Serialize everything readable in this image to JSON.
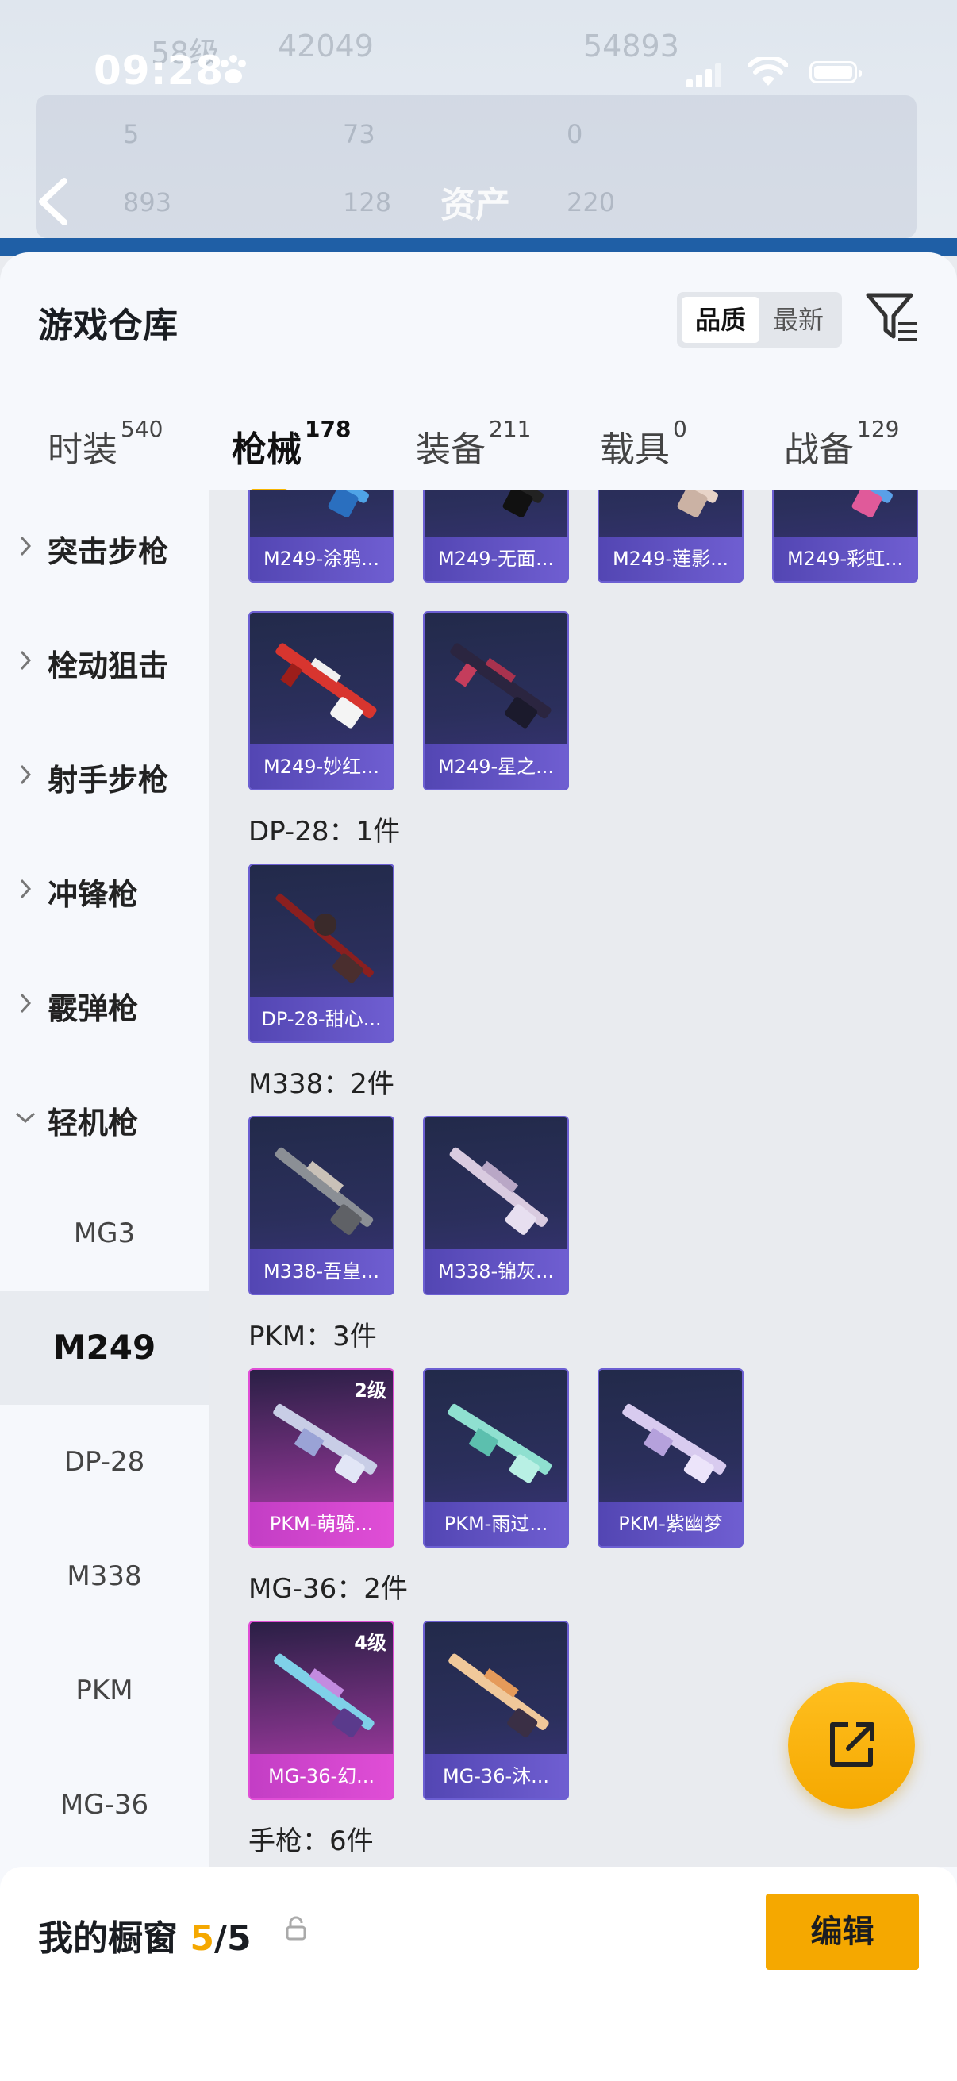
{
  "status_bar": {
    "time": "09:28"
  },
  "background": {
    "ghost_texts": [
      "58级",
      "42049",
      "54893",
      "5",
      "73",
      "0",
      "893",
      "128",
      "220"
    ],
    "title": "资产"
  },
  "sheet": {
    "title": "游戏仓库",
    "sort_options": [
      {
        "label": "品质",
        "active": true
      },
      {
        "label": "最新",
        "active": false
      }
    ]
  },
  "tabs": [
    {
      "label": "时装",
      "count": "540"
    },
    {
      "label": "枪械",
      "count": "178",
      "active": true
    },
    {
      "label": "装备",
      "count": "211"
    },
    {
      "label": "载具",
      "count": "0"
    },
    {
      "label": "战备",
      "count": "129"
    }
  ],
  "sidebar": {
    "categories": [
      {
        "label": "突击步枪",
        "expanded": false
      },
      {
        "label": "栓动狙击",
        "expanded": false
      },
      {
        "label": "射手步枪",
        "expanded": false
      },
      {
        "label": "冲锋枪",
        "expanded": false
      },
      {
        "label": "霰弹枪",
        "expanded": false
      },
      {
        "label": "轻机枪",
        "expanded": true
      }
    ],
    "subitems": [
      {
        "label": "MG3"
      },
      {
        "label": "M249",
        "active": true
      },
      {
        "label": "DP-28"
      },
      {
        "label": "M338"
      },
      {
        "label": "PKM"
      },
      {
        "label": "MG-36"
      }
    ]
  },
  "content": {
    "m249_top_row": [
      "M249-涂鸦...",
      "M249-无面...",
      "M249-莲影...",
      "M249-彩虹..."
    ],
    "m249_second_row": [
      "M249-妙红...",
      "M249-星之..."
    ],
    "groups": [
      {
        "title": "DP-28：1件",
        "items": [
          {
            "name": "DP-28-甜心...",
            "rarity": "purple"
          }
        ]
      },
      {
        "title": "M338：2件",
        "items": [
          {
            "name": "M338-吾皇...",
            "rarity": "purple"
          },
          {
            "name": "M338-锦灰...",
            "rarity": "purple"
          }
        ]
      },
      {
        "title": "PKM：3件",
        "items": [
          {
            "name": "PKM-萌骑...",
            "rarity": "pink",
            "level": "2级"
          },
          {
            "name": "PKM-雨过...",
            "rarity": "purple"
          },
          {
            "name": "PKM-紫幽梦",
            "rarity": "purple"
          }
        ]
      },
      {
        "title": "MG-36：2件",
        "items": [
          {
            "name": "MG-36-幻...",
            "rarity": "pink",
            "level": "4级"
          },
          {
            "name": "MG-36-沐...",
            "rarity": "purple"
          }
        ]
      },
      {
        "title": "手枪：6件",
        "items": []
      }
    ],
    "colors": {
      "purple_card": "#5346b3",
      "pink_card": "#d846d0",
      "accent": "#f5a800"
    }
  },
  "bottom_bar": {
    "label": "我的橱窗",
    "current": "5",
    "separator": "/",
    "total": "5",
    "edit_label": "编辑"
  },
  "icons": [
    "back-icon",
    "paw-icon",
    "signal-icon",
    "wifi-icon",
    "battery-icon",
    "filter-icon",
    "chevron-right-icon",
    "chevron-down-icon",
    "share-icon",
    "lock-icon"
  ]
}
